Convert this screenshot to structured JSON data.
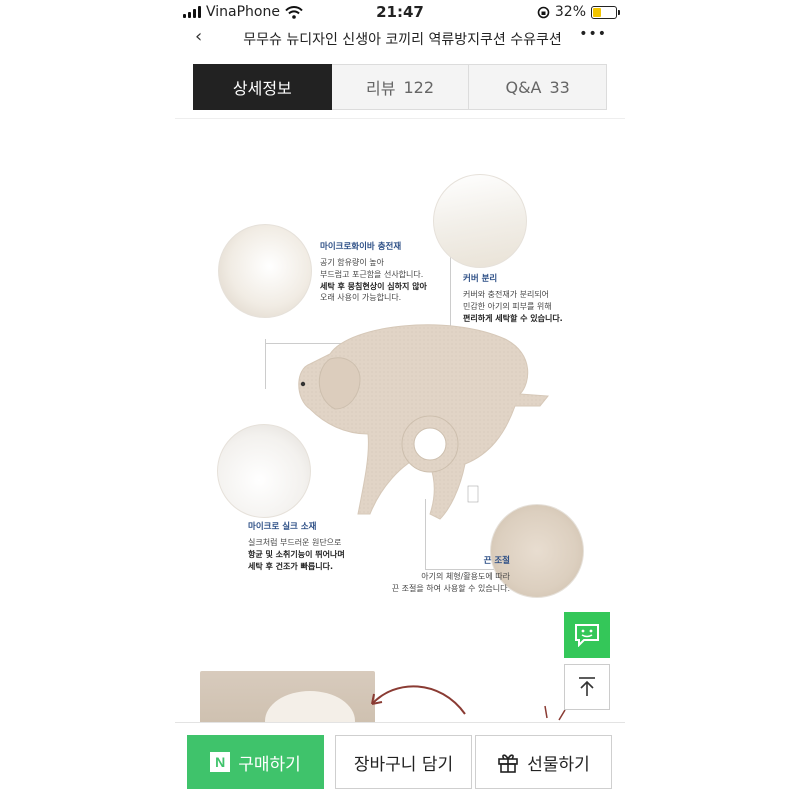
{
  "status": {
    "carrier": "VinaPhone",
    "time": "21:47",
    "battery": "32%",
    "battery_level": 0.32
  },
  "nav": {
    "title": "무무슈 뉴디자인 신생아 코끼리 역류방지쿠션 수유쿠션",
    "back_icon": "chevron-left-icon",
    "more_icon": "more-icon"
  },
  "tabs": [
    {
      "label": "상세정보",
      "count": ""
    },
    {
      "label": "리뷰",
      "count": "122"
    },
    {
      "label": "Q&A",
      "count": "33"
    }
  ],
  "features": {
    "microfiber": {
      "title": "마이크로화이바 충전재",
      "lines": [
        "공기 함유량이 높아",
        "부드럽고 포근함을 선사합니다.",
        "세탁 후 뭉침현상이 심하지 않아",
        "오래 사용이 가능합니다."
      ]
    },
    "cover": {
      "title": "커버 분리",
      "lines": [
        "커버와 충전재가 분리되어",
        "민감한 아기의 피부를 위해",
        "편리하게 세탁할 수 있습니다."
      ]
    },
    "silk": {
      "title": "마이크로 실크 소재",
      "lines": [
        "실크처럼 부드러운 원단으로",
        "항균 및 소취기능이 뛰어나며",
        "세탁 후 건조가 빠릅니다."
      ]
    },
    "strap": {
      "title": "끈 조절",
      "lines": [
        "아기의 체형/활용도에 따라",
        "끈 조절을 하여 사용할 수 있습니다."
      ]
    }
  },
  "colors": {
    "buy_green": "#3fc36b",
    "tab_active_bg": "#222222",
    "caption_blue": "#2d4f86",
    "pillow_beige": "#e1d4c6"
  },
  "floating": {
    "chat_icon": "chat-icon",
    "top_icon": "arrow-up-icon"
  },
  "bottom": {
    "buy_label": "구매하기",
    "buy_badge": "N",
    "cart_label": "장바구니 담기",
    "gift_label": "선물하기",
    "gift_icon": "gift-icon"
  }
}
